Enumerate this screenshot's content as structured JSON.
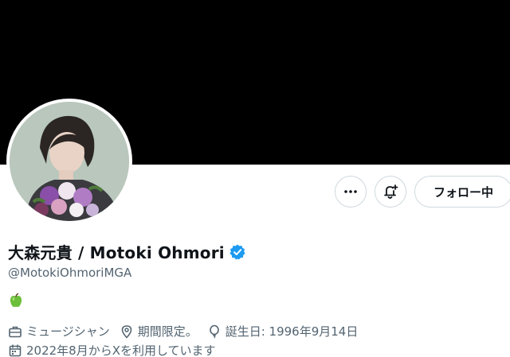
{
  "profile": {
    "display_name": "大森元貴 / Motoki Ohmori",
    "handle": "@MotokiOhmoriMGA",
    "bio_emoji": "green-apple-icon",
    "verified": true
  },
  "actions": {
    "more_icon": "more-icon",
    "notify_icon": "bell-plus-icon",
    "follow_label": "フォロー中"
  },
  "meta": {
    "category": "ミュージシャン",
    "location": "期間限定。",
    "birthday": "誕生日: 1996年9月14日",
    "joined": "2022年8月からXを利用しています"
  },
  "colors": {
    "banner": "#000000",
    "verified_blue": "#1d9bf0",
    "secondary_text": "#536471",
    "border": "#cfd9de"
  }
}
